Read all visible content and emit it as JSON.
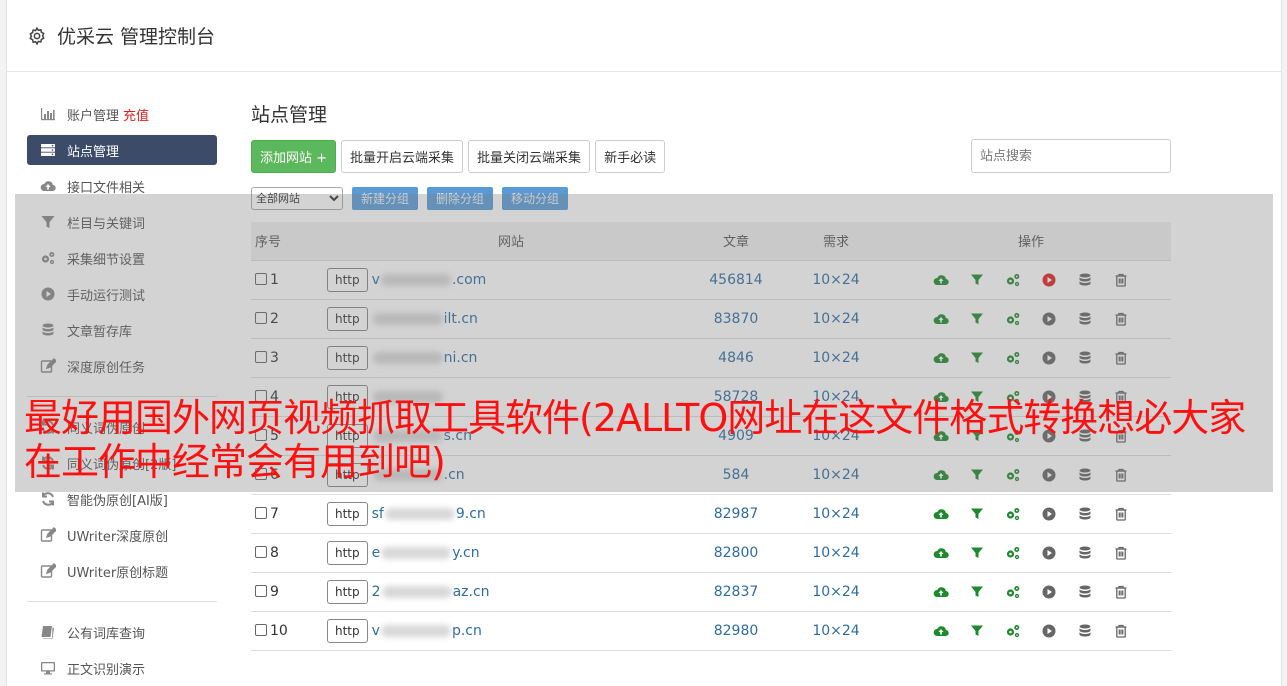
{
  "header": {
    "title": "优采云 管理控制台"
  },
  "sidebar": {
    "items": [
      {
        "label": "账户管理",
        "extra": "充值",
        "icon": "bar-chart-icon"
      },
      {
        "label": "站点管理",
        "icon": "server-icon",
        "active": true
      },
      {
        "label": "接口文件相关",
        "icon": "cloud-upload-icon"
      },
      {
        "label": "栏目与关键词",
        "icon": "filter-icon"
      },
      {
        "label": "采集细节设置",
        "icon": "gears-icon"
      },
      {
        "label": "手动运行测试",
        "icon": "play-circle-icon"
      },
      {
        "label": "文章暂存库",
        "icon": "database-icon"
      },
      {
        "label": "深度原创任务",
        "icon": "edit-icon"
      }
    ],
    "items2": [
      {
        "label": "同义词伪原创",
        "icon": "refresh-icon"
      },
      {
        "label": "同义词伪原创[2版]",
        "icon": "refresh-icon"
      },
      {
        "label": "智能伪原创[AI版]",
        "icon": "refresh-icon"
      },
      {
        "label": "UWriter深度原创",
        "icon": "edit-icon"
      },
      {
        "label": "UWriter原创标题",
        "icon": "edit-icon"
      }
    ],
    "items3": [
      {
        "label": "公有词库查询",
        "icon": "book-icon"
      },
      {
        "label": "正文识别演示",
        "icon": "monitor-icon"
      }
    ]
  },
  "main": {
    "title": "站点管理",
    "buttons": {
      "add": "添加网站 +",
      "batch_on": "批量开启云端采集",
      "batch_off": "批量关闭云端采集",
      "guide": "新手必读"
    },
    "search_placeholder": "站点搜索",
    "group_select": "全部网站",
    "group_buttons": {
      "new": "新建分组",
      "delete": "删除分组",
      "move": "移动分组"
    },
    "columns": {
      "no": "序号",
      "site": "网站",
      "articles": "文章",
      "need": "需求",
      "ops": "操作"
    },
    "rows": [
      {
        "no": "1",
        "proto": "http",
        "pre": "v",
        "post": ".com",
        "articles": "456814",
        "need": "10×24",
        "running": true
      },
      {
        "no": "2",
        "proto": "http",
        "pre": "",
        "post": "ilt.cn",
        "articles": "83870",
        "need": "10×24",
        "running": false
      },
      {
        "no": "3",
        "proto": "http",
        "pre": "",
        "post": "ni.cn",
        "articles": "4846",
        "need": "10×24",
        "running": false
      },
      {
        "no": "4",
        "proto": "http",
        "pre": "",
        "post": "",
        "articles": "58728",
        "need": "10×24",
        "running": false
      },
      {
        "no": "5",
        "proto": "http",
        "pre": "",
        "post": "s.cn",
        "articles": "4909",
        "need": "10×24",
        "running": false
      },
      {
        "no": "6",
        "proto": "http",
        "pre": "",
        "post": ".cn",
        "articles": "584",
        "need": "10×24",
        "running": false
      },
      {
        "no": "7",
        "proto": "http",
        "pre": "sf",
        "post": "9.cn",
        "articles": "82987",
        "need": "10×24",
        "running": false
      },
      {
        "no": "8",
        "proto": "http",
        "pre": "e",
        "post": "y.cn",
        "articles": "82800",
        "need": "10×24",
        "running": false
      },
      {
        "no": "9",
        "proto": "http",
        "pre": "2",
        "post": "az.cn",
        "articles": "82837",
        "need": "10×24",
        "running": false
      },
      {
        "no": "10",
        "proto": "http",
        "pre": "v",
        "post": "p.cn",
        "articles": "82980",
        "need": "10×24",
        "running": false
      }
    ]
  },
  "banner": {
    "text": "最好用国外网页视频抓取工具软件(2ALLTO网址在这文件格式转换想必大家在工作中经常会有用到吧)"
  },
  "colors": {
    "accent_green": "#5cb85c",
    "sidebar_active": "#3c4c68",
    "link_blue": "#2d6ca2",
    "banner_red": "#ff1010"
  }
}
